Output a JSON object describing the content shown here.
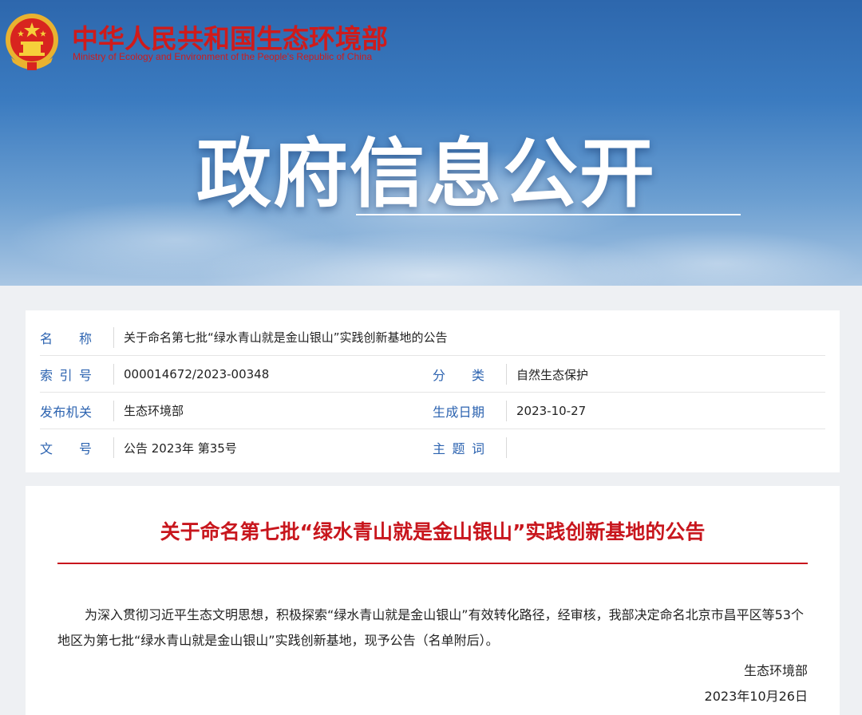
{
  "header": {
    "org_name_cn": "中华人民共和国生态环境部",
    "org_name_en": "Ministry of Ecology and Environment of the People's Republic of China",
    "banner_title": "政府信息公开",
    "emblem_icon": "national-emblem-icon",
    "brand_color": "#cf1b1b"
  },
  "meta": {
    "name_label": "名　称",
    "name_value": "关于命名第七批“绿水青山就是金山银山”实践创新基地的公告",
    "index_label": "索引号",
    "index_value": "000014672/2023-00348",
    "category_label": "分　类",
    "category_value": "自然生态保护",
    "issuer_label": "发布机关",
    "issuer_value": "生态环境部",
    "date_label": "生成日期",
    "date_value": "2023-10-27",
    "doc_no_label": "文　号",
    "doc_no_value": "公告 2023年 第35号",
    "keywords_label": "主题词",
    "keywords_value": "",
    "label_color": "#2c63b0"
  },
  "article": {
    "title": "关于命名第七批“绿水青山就是金山银山”实践创新基地的公告",
    "body": "为深入贯彻习近平生态文明思想，积极探索“绿水青山就是金山银山”有效转化路径，经审核，我部决定命名北京市昌平区等53个地区为第七批“绿水青山就是金山银山”实践创新基地，现予公告（名单附后）。",
    "signature": "生态环境部",
    "sign_date": "2023年10月26日",
    "title_color": "#c8161d"
  }
}
